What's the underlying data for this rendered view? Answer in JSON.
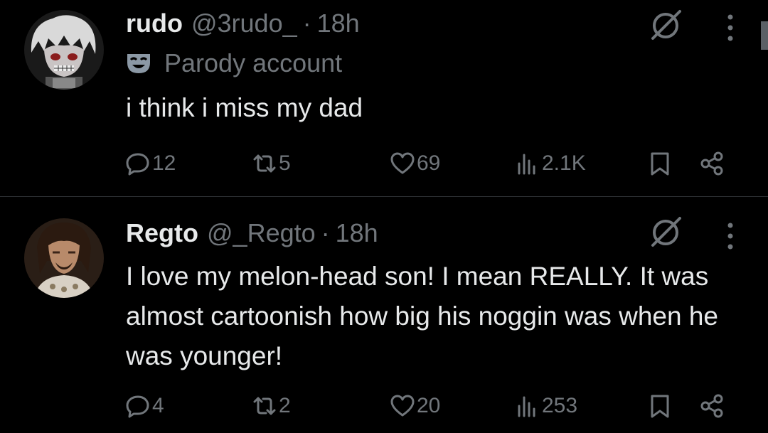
{
  "tweets": [
    {
      "name": "rudo",
      "handle": "@3rudo_",
      "dot": "·",
      "time": "18h",
      "badge_label": "Parody account",
      "text": "i think i miss my dad",
      "replies": "12",
      "reposts": "5",
      "likes": "69",
      "views": "2.1K"
    },
    {
      "name": "Regto",
      "handle": "@_Regto",
      "dot": "·",
      "time": "18h",
      "text": "I love my melon-head son! I mean REALLY. It was almost cartoonish how big his noggin was when he was younger!",
      "replies": "4",
      "reposts": "2",
      "likes": "20",
      "views": "253"
    }
  ],
  "colors": {
    "background": "#000000",
    "primary_text": "#e7e9ea",
    "secondary_text": "#71767b",
    "divider": "#2f3336",
    "parody_mask": "#8b98a5"
  },
  "icons": [
    "grok-icon",
    "more-icon",
    "parody-mask-icon",
    "reply-icon",
    "repost-icon",
    "like-icon",
    "views-icon",
    "bookmark-icon",
    "share-icon"
  ]
}
